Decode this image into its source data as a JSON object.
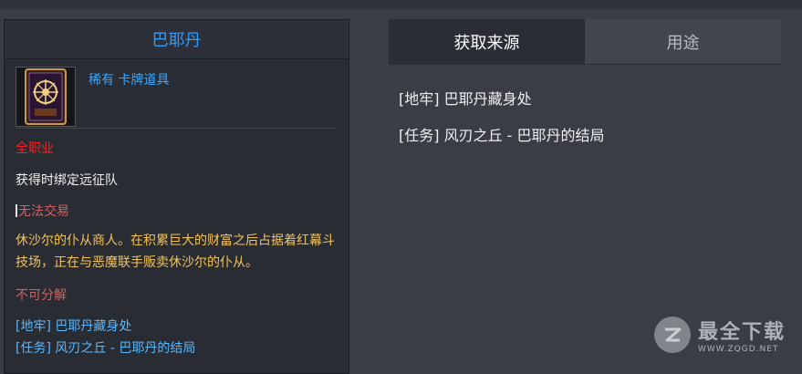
{
  "item": {
    "name": "巴耶丹",
    "type_text": "稀有  卡牌道具",
    "class_req": "全职业",
    "bind": "获得时绑定远征队",
    "trade": "无法交易",
    "description": "休沙尔的仆从商人。在积累巨大的财富之后占据着红幕斗技场，正在与恶魔联手贩卖休沙尔的仆从。",
    "dismantle": "不可分解",
    "sources": [
      "[地牢] 巴耶丹藏身处",
      "[任务] 风刃之丘 - 巴耶丹的结局"
    ]
  },
  "tabs": [
    {
      "label": "获取来源",
      "active": true
    },
    {
      "label": "用途",
      "active": false
    }
  ],
  "source_list": [
    "[地牢] 巴耶丹藏身处",
    "[任务] 风刃之丘 - 巴耶丹的结局"
  ],
  "watermark": {
    "main": "最全下载",
    "sub": "WWW.ZQGD.NET"
  },
  "colors": {
    "title": "#2f9bff",
    "rarity": "#39a7ff",
    "class_req": "#ff1e1e",
    "untradeable": "#d26262",
    "description": "#f2c25a",
    "source_link": "#58b8ff"
  }
}
